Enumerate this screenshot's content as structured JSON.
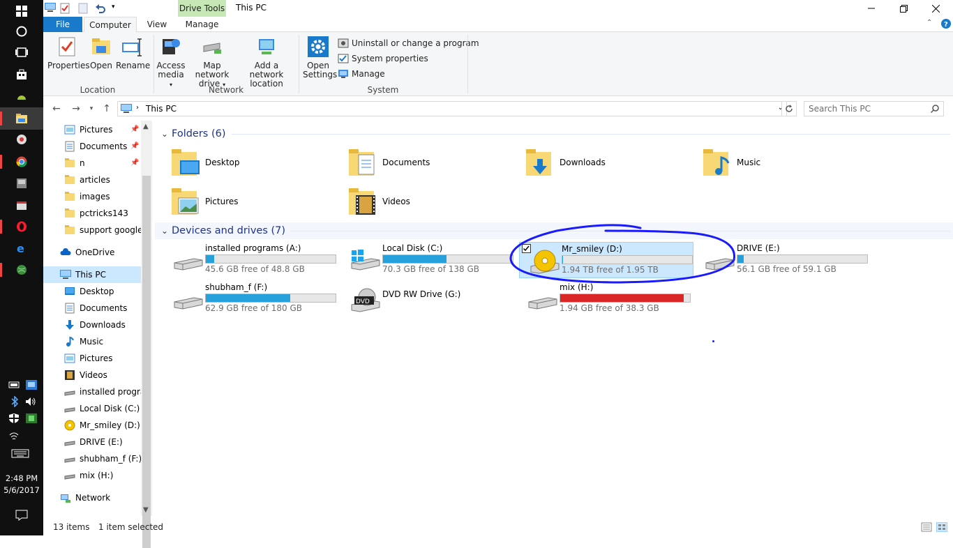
{
  "taskbar": {
    "clock_time": "2:48 PM",
    "clock_date": "5/6/2017",
    "icons": [
      "windows-icon",
      "cortana-icon",
      "task-view-icon",
      "store-icon",
      "android-icon",
      "file-explorer-icon",
      "app-icon",
      "chrome-icon",
      "app-icon",
      "app-icon",
      "opera-icon",
      "edge-icon",
      "globe-icon"
    ],
    "tray_icons": [
      "battery-icon",
      "network-monitor-icon",
      "bluetooth-icon",
      "volume-icon",
      "security-icon",
      "nvidia-icon",
      "wifi-icon",
      "keyboard-icon"
    ]
  },
  "window": {
    "title": "This PC",
    "drive_tools": "Drive Tools",
    "tabs": {
      "file": "File",
      "computer": "Computer",
      "view": "View",
      "manage": "Manage"
    }
  },
  "ribbon": {
    "location": {
      "label": "Location",
      "properties": "Properties",
      "open": "Open",
      "rename": "Rename"
    },
    "network": {
      "label": "Network",
      "access_media_1": "Access",
      "access_media_2": "media",
      "map_drive_1": "Map network",
      "map_drive_2": "drive",
      "add_location_1": "Add a network",
      "add_location_2": "location"
    },
    "system": {
      "label": "System",
      "open_settings_1": "Open",
      "open_settings_2": "Settings",
      "uninstall": "Uninstall or change a program",
      "system_properties": "System properties",
      "manage": "Manage"
    }
  },
  "address": {
    "path": "This PC",
    "search_placeholder": "Search This PC"
  },
  "nav_pane": {
    "quick": [
      {
        "label": "Pictures",
        "pinned": true
      },
      {
        "label": "Documents",
        "pinned": true
      },
      {
        "label": "n",
        "pinned": true
      },
      {
        "label": "articles"
      },
      {
        "label": "images"
      },
      {
        "label": "pctricks143"
      },
      {
        "label": "support google"
      }
    ],
    "onedrive": "OneDrive",
    "this_pc": "This PC",
    "pc_items": [
      "Desktop",
      "Documents",
      "Downloads",
      "Music",
      "Pictures",
      "Videos",
      "installed program",
      "Local Disk (C:)",
      "Mr_smiley (D:)",
      "DRIVE (E:)",
      "shubham_f (F:)",
      "mix (H:)"
    ],
    "network": "Network"
  },
  "content": {
    "folders_header": "Folders (6)",
    "folders": [
      "Desktop",
      "Documents",
      "Downloads",
      "Music",
      "Pictures",
      "Videos"
    ],
    "drives_header": "Devices and drives (7)",
    "drives": [
      {
        "name": "installed programs (A:)",
        "free": "45.6 GB free of 48.8 GB",
        "used_fraction": 0.066
      },
      {
        "name": "Local Disk (C:)",
        "free": "70.3 GB free of 138 GB",
        "used_fraction": 0.49
      },
      {
        "name": "Mr_smiley (D:)",
        "free": "1.94 TB free of 1.95 TB",
        "used_fraction": 0.005
      },
      {
        "name": "DRIVE (E:)",
        "free": "56.1 GB free of 59.1 GB",
        "used_fraction": 0.051
      },
      {
        "name": "shubham_f (F:)",
        "free": "62.9 GB free of 180 GB",
        "used_fraction": 0.65
      },
      {
        "name": "DVD RW Drive (G:)"
      },
      {
        "name": "mix (H:)",
        "free": "1.94 GB free of 38.3 GB",
        "used_fraction": 0.95
      }
    ],
    "annotation_color": "#1a1aff"
  },
  "status": {
    "items": "13 items",
    "selected": "1 item selected"
  },
  "colors": {
    "accent": "#1979ca",
    "selection": "#cce8ff",
    "drive_bar": "#26a0da",
    "drive_bar_full": "#da2626"
  }
}
